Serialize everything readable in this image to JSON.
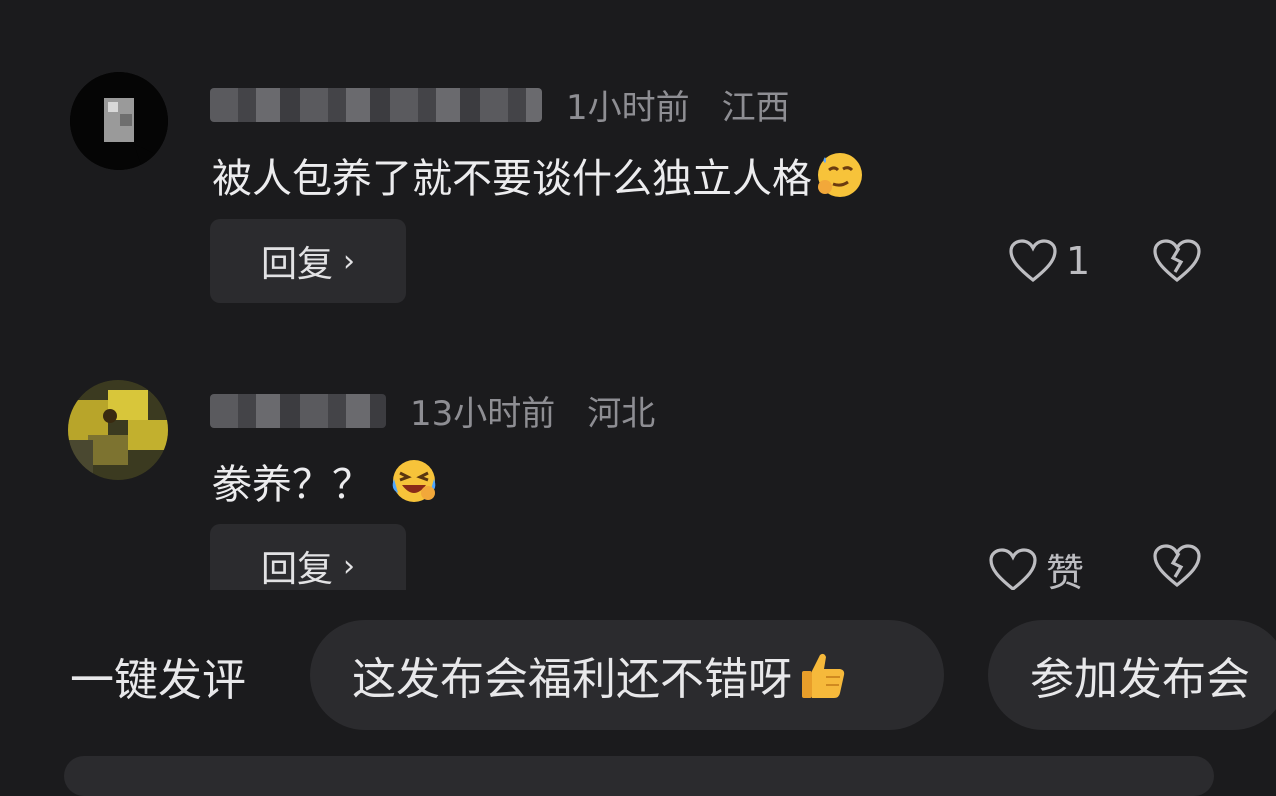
{
  "comments": [
    {
      "time": "1小时前",
      "location": "江西",
      "text": "被人包养了就不要谈什么独立人格",
      "emoji": "smirk-emoji",
      "reply_label": "回复",
      "like_count": "1"
    },
    {
      "time": "13小时前",
      "location": "河北",
      "text": "豢养？？",
      "emoji": "laughing-tears-emoji",
      "reply_label": "回复",
      "like_count": "赞"
    }
  ],
  "suggestions": {
    "label": "一键发评",
    "chips": [
      "这发布会福利还不错呀",
      "参加发布会"
    ]
  },
  "colors": {
    "background": "#1b1b1d",
    "chip_background": "#2b2b2e",
    "meta_text": "#8e8e93"
  }
}
